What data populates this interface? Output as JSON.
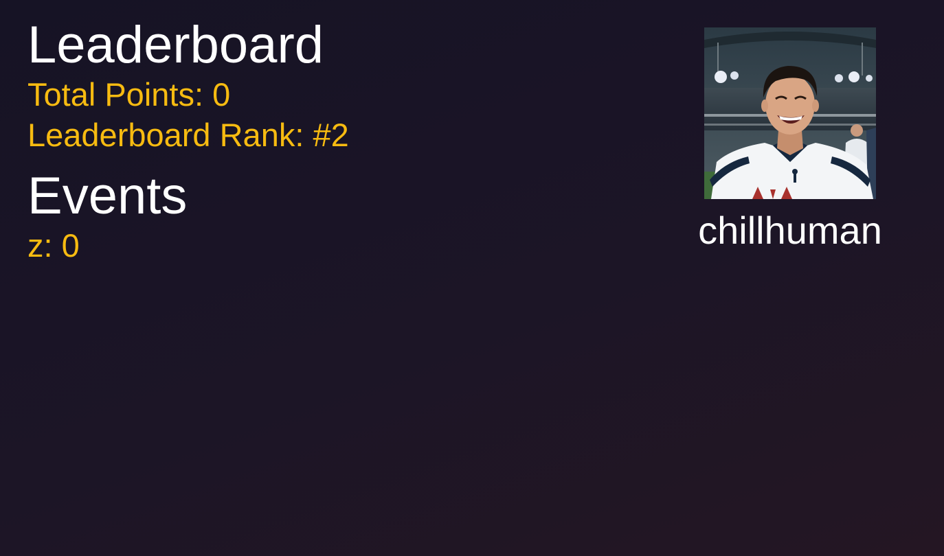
{
  "leaderboard": {
    "title": "Leaderboard",
    "total_points": "Total Points: 0",
    "rank": "Leaderboard Rank: #2"
  },
  "events": {
    "title": "Events",
    "items": [
      {
        "label": "z: 0"
      }
    ]
  },
  "profile": {
    "avatar_icon": "user-photo",
    "username": "chillhuman"
  },
  "colors": {
    "accent": "#f7bb11",
    "text": "#ffffff",
    "background": "#1a1526"
  }
}
